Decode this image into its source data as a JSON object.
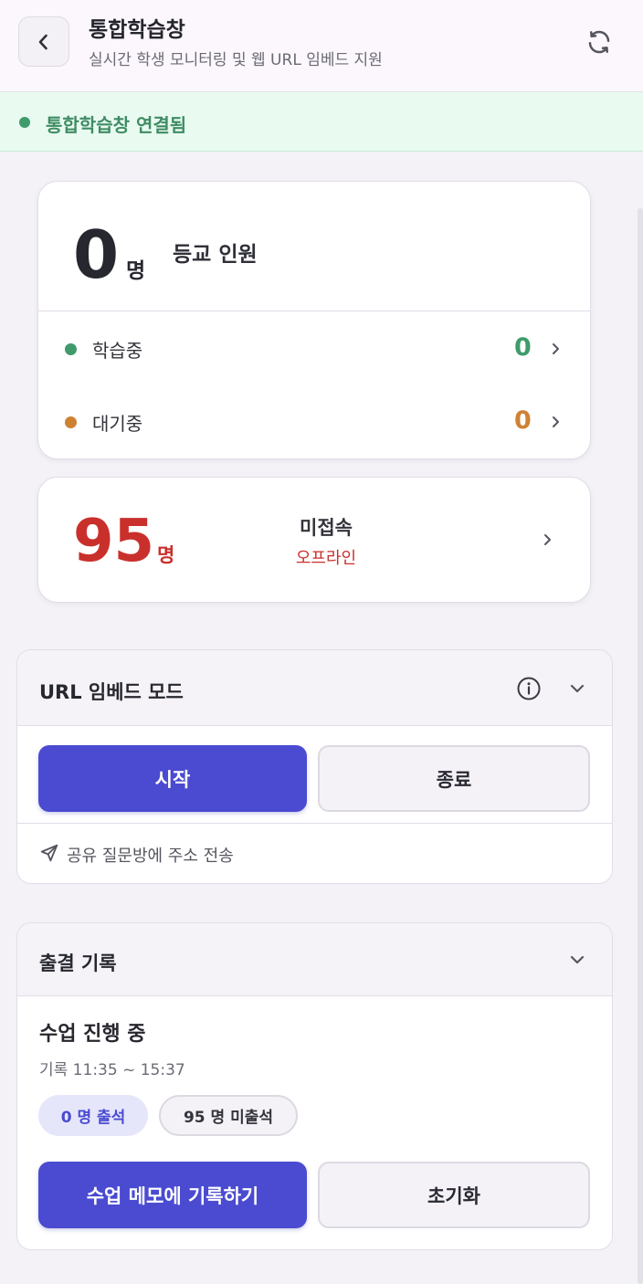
{
  "header": {
    "title": "통합학습창",
    "subtitle": "실시간 학생 모니터링 및 웹 URL 임베드 지원"
  },
  "status": {
    "text": "통합학습창 연결됨",
    "color": "#3f9b6b"
  },
  "attendance_card": {
    "count": "0",
    "unit": "명",
    "label": "등교 인원",
    "rows": [
      {
        "label": "학습중",
        "value": "0",
        "color": "#3f9b6b"
      },
      {
        "label": "대기중",
        "value": "0",
        "color": "#cf8132"
      }
    ]
  },
  "offline_card": {
    "count": "95",
    "unit": "명",
    "label": "미접속",
    "sublabel": "오프라인",
    "color": "#c9302c"
  },
  "url_embed": {
    "title": "URL 임베드 모드",
    "start_label": "시작",
    "stop_label": "종료",
    "send_label": "공유 질문방에 주소 전송"
  },
  "attendance_log": {
    "title": "출결 기록",
    "status_title": "수업 진행 중",
    "time_range": "기록 11:35 ~ 15:37",
    "present_pill": "0 명 출석",
    "absent_pill": "95 명 미출석",
    "memo_button": "수업 메모에 기록하기",
    "reset_button": "초기화"
  },
  "colors": {
    "accent": "#4a4bd0",
    "present": "#3f9b6b",
    "waiting": "#cf8132",
    "offline": "#c9302c"
  }
}
